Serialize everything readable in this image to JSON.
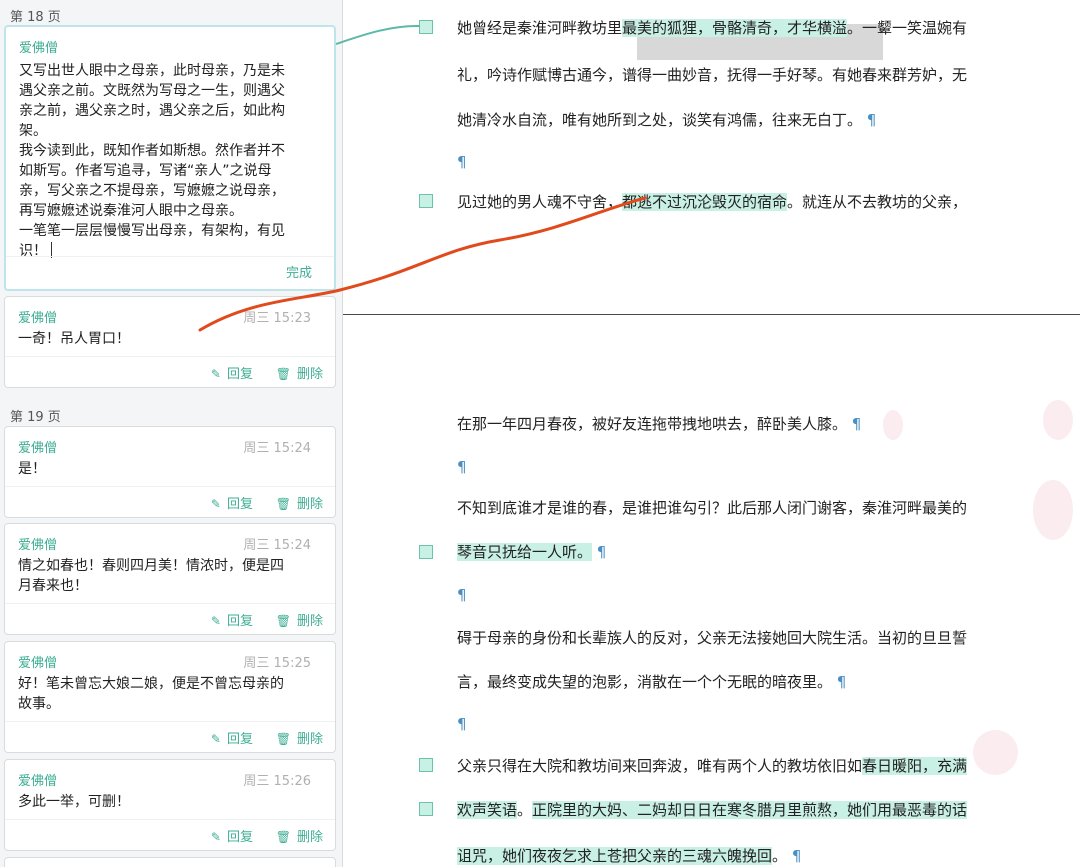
{
  "sidebar": {
    "page18_label": "第 18 页",
    "page19_label": "第 19 页",
    "editing_card": {
      "author": "爱佛僧",
      "lines": [
        "又写出世人眼中之母亲，此时母亲，乃是未",
        "遇父亲之前。文既然为写母之一生，则遇父",
        "亲之前，遇父亲之时，遇父亲之后，如此构",
        "架。",
        "我今读到此，既知作者如斯想。然作者并不",
        "如斯写。作者写追寻，写诸“亲人”之说母",
        "亲，写父亲之不提母亲，写嬷嬷之说母亲，",
        "再写嬷嬷述说秦淮河人眼中之母亲。",
        "一笔笔一层层慢慢写出母亲，有架构，有见",
        "识！"
      ],
      "done_label": "完成"
    },
    "comments": [
      {
        "author": "爱佛僧",
        "time": "周三 15:23",
        "text": "一奇！吊人胃口！"
      },
      {
        "author": "爱佛僧",
        "time": "周三 15:24",
        "text": "是！"
      },
      {
        "author": "爱佛僧",
        "time": "周三 15:24",
        "text": "情之如春也！春则四月美！情浓时，便是四\n月春来也！"
      },
      {
        "author": "爱佛僧",
        "time": "周三 15:25",
        "text": "好！笔未曾忘大娘二娘，便是不曾忘母亲的\n故事。"
      },
      {
        "author": "爱佛僧",
        "time": "周三 15:26",
        "text": "多此一举，可删！"
      }
    ],
    "reply_label": "回复",
    "delete_label": "删除",
    "reply_icon": "pencil-icon",
    "delete_icon": "trash-icon"
  },
  "doc": {
    "top": {
      "l1": {
        "pre": "她曾经是秦淮河畔教坊里",
        "hl": "最美的狐狸，骨骼清奇，才华横溢",
        "post": "。一颦一笑温婉有"
      },
      "l2": "礼，吟诗作赋博古通今，谱得一曲妙音，抚得一手好琴。有她春来群芳妒，无",
      "l3": "她清冷水自流，唯有她所到之处，谈笑有鸿儒，往来无白丁。",
      "l5": {
        "pre": "见过她的男人魂不守舍，",
        "hl": "都逃不过沉沦毁灭的宿命",
        "post": "。就连从不去教坊的父亲，"
      }
    },
    "bottom": {
      "b1": "在那一年四月春夜，被好友连拖带拽地哄去，醉卧美人膝。",
      "b3": "不知到底谁才是谁的春，是谁把谁勾引？此后那人闭门谢客，秦淮河畔最美的",
      "b4": "琴音只抚给一人听。",
      "b6": "碍于母亲的身份和长辈族人的反对，父亲无法接她回大院生活。当初的旦旦誓",
      "b7": "言，最终变成失望的泡影，消散在一个个无眠的暗夜里。",
      "b9": {
        "pre": "父亲只得在大院和教坊间来回奔波，唯有两个人的教坊依旧如",
        "hl": "春日暖阳，充满"
      },
      "b10": {
        "hl1": "欢声笑语",
        "mid": "。",
        "hl2": "正院里的大妈、二妈却日日在寒冬腊月里煎熬，她们用最恶毒的话"
      },
      "b11": {
        "hl": "诅咒，她们夜夜乞求上苍把父亲的三魂六魄挽回",
        "post": "。"
      }
    },
    "pilcrow": "¶"
  },
  "colors": {
    "accent": "#3fae94",
    "highlight": "#c9f0e4",
    "connector": "#e04a1c",
    "teal_connector": "#5bb9a8"
  }
}
